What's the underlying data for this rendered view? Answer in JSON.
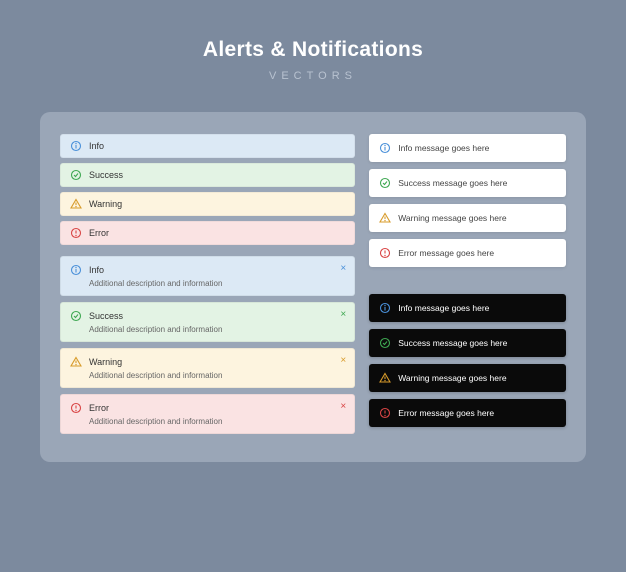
{
  "header": {
    "title": "Alerts & Notifications",
    "subtitle": "VECTORS"
  },
  "small_alerts": [
    {
      "type": "info",
      "label": "Info"
    },
    {
      "type": "success",
      "label": "Success"
    },
    {
      "type": "warning",
      "label": "Warning"
    },
    {
      "type": "error",
      "label": "Error"
    }
  ],
  "large_alerts": [
    {
      "type": "info",
      "label": "Info",
      "desc": "Additional description and information"
    },
    {
      "type": "success",
      "label": "Success",
      "desc": "Additional description and information"
    },
    {
      "type": "warning",
      "label": "Warning",
      "desc": "Additional description and information"
    },
    {
      "type": "error",
      "label": "Error",
      "desc": "Additional description and information"
    }
  ],
  "toasts_light": [
    {
      "type": "info",
      "text": "Info message goes here"
    },
    {
      "type": "success",
      "text": "Success message goes here"
    },
    {
      "type": "warning",
      "text": "Warning message goes here"
    },
    {
      "type": "error",
      "text": "Error message goes here"
    }
  ],
  "toasts_dark": [
    {
      "type": "info",
      "text": "Info message goes here"
    },
    {
      "type": "success",
      "text": "Success message goes here"
    },
    {
      "type": "warning",
      "text": "Warning message goes here"
    },
    {
      "type": "error",
      "text": "Error message goes here"
    }
  ],
  "close_glyph": "×",
  "colors": {
    "info": "#4a90d9",
    "success": "#3fa852",
    "warning": "#d89b2a",
    "error": "#d94545"
  }
}
